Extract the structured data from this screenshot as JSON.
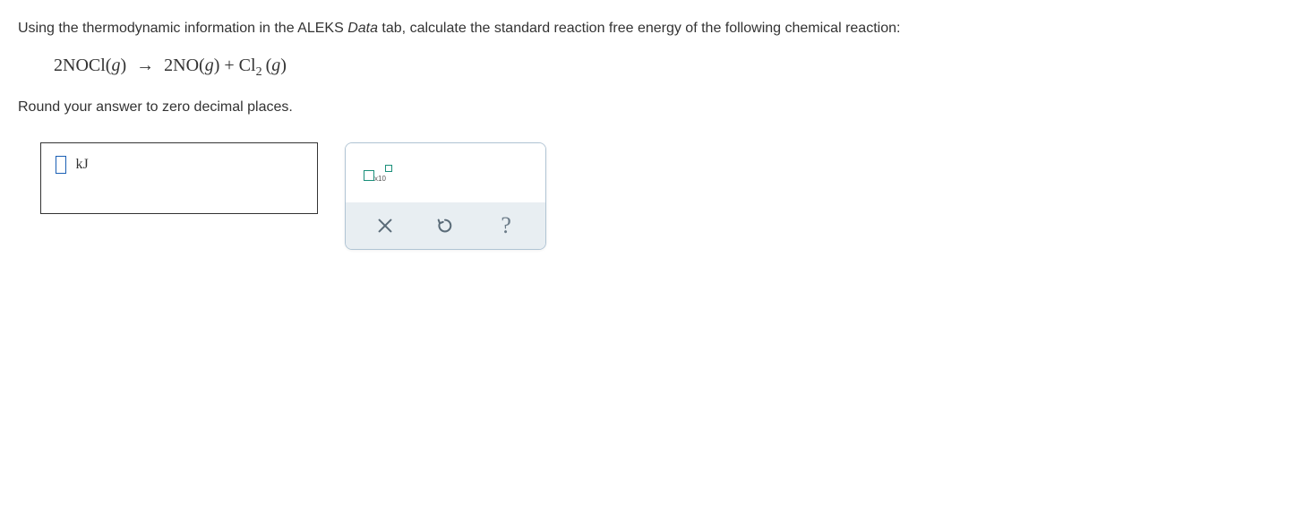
{
  "question": {
    "text_before_italic": "Using the thermodynamic information in the ALEKS ",
    "italic_word": "Data",
    "text_after_italic": " tab, calculate the standard reaction free energy of the following chemical reaction:"
  },
  "equation": {
    "reactant_coef": "2",
    "reactant_formula": "NOCl",
    "reactant_state": "g",
    "product1_coef": "2",
    "product1_formula": "NO",
    "product1_state": "g",
    "product2_formula": "Cl",
    "product2_sub": "2",
    "product2_state": "g"
  },
  "instruction": "Round your answer to zero decimal places.",
  "answer": {
    "unit": "kJ",
    "value": ""
  },
  "tools": {
    "sci_label": "x10"
  }
}
